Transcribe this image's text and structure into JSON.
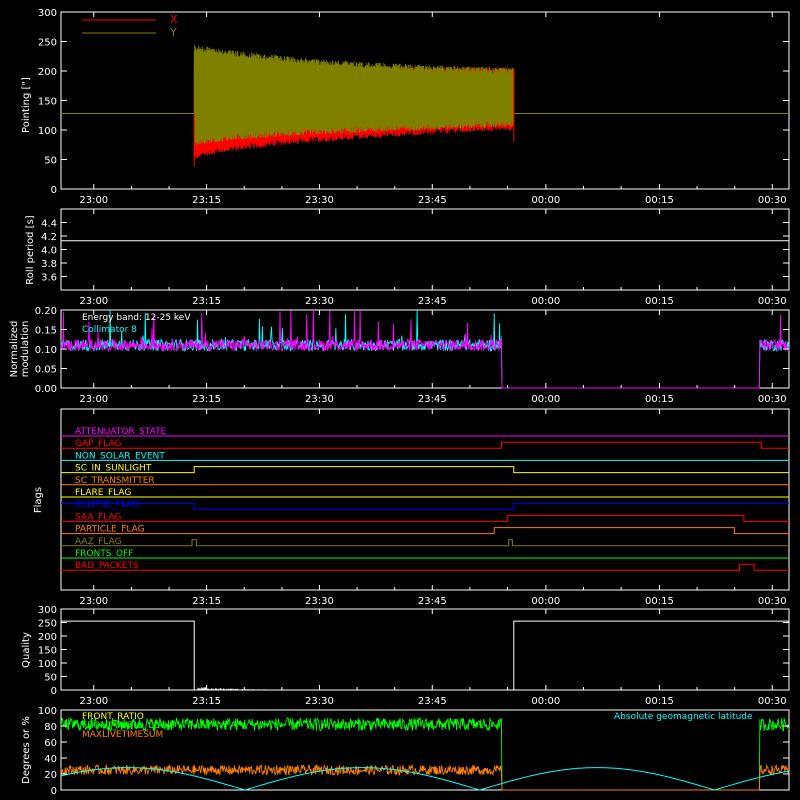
{
  "time_ticks": [
    "23:00",
    "23:15",
    "23:30",
    "23:45",
    "00:00",
    "00:15",
    "00:30"
  ],
  "colors": {
    "x": "#ff0000",
    "y": "#808000",
    "white": "#ffffff",
    "magenta": "#ff00ff",
    "cyan": "#00ffff",
    "green": "#00ff00",
    "orange": "#ff8000",
    "yellow": "#ffff00",
    "blue": "#0000ff",
    "red": "#ff0000",
    "olive": "#808000"
  },
  "chart_data": [
    {
      "id": "pointing",
      "type": "line",
      "ylabel": "Pointing [\"]",
      "ylim": [
        0,
        300
      ],
      "yticks": [
        "0",
        "50",
        "100",
        "150",
        "200",
        "250",
        "300"
      ],
      "legend": [
        {
          "name": "X",
          "color": "#ff0000"
        },
        {
          "name": "Y",
          "color": "#808000"
        }
      ],
      "series": [
        {
          "name": "X",
          "baseline": 128,
          "active": [
            [
              0.183,
              0.622
            ]
          ],
          "low_start": 45,
          "low_end": 100,
          "high_start": 210,
          "high_end": 205
        },
        {
          "name": "Y",
          "baseline": 128,
          "active": [
            [
              0.183,
              0.622
            ]
          ],
          "low_start": 70,
          "low_end": 105,
          "high_start": 245,
          "high_end": 200
        }
      ]
    },
    {
      "id": "roll",
      "type": "line",
      "ylabel": "Roll period [s]",
      "ylim": [
        3.4,
        4.6
      ],
      "yticks": [
        "3.6",
        "3.8",
        "4.0",
        "4.2",
        "4.4"
      ],
      "series": [
        {
          "name": "roll",
          "value": 4.13
        }
      ]
    },
    {
      "id": "modulation",
      "type": "line",
      "ylabel_lines": [
        "Normalized",
        "modulation"
      ],
      "ylim": [
        0,
        0.2
      ],
      "yticks": [
        "0.00",
        "0.05",
        "0.10",
        "0.15",
        "0.20"
      ],
      "annotations": [
        "Energy band: 12-25 keV",
        "Collimator 8"
      ],
      "series": [
        {
          "name": "cyan",
          "mean": 0.11,
          "active": [
            [
              0.0,
              0.605
            ],
            [
              0.96,
              1.0
            ]
          ]
        },
        {
          "name": "magenta",
          "mean": 0.11,
          "active": [
            [
              0.0,
              0.605
            ],
            [
              0.96,
              1.0
            ]
          ]
        }
      ]
    },
    {
      "id": "flags",
      "type": "line",
      "ylabel": "Flags",
      "series": [
        {
          "name": "ATTENUATOR_STATE",
          "color": "#ff00ff",
          "segments": [
            [
              0,
              1.0,
              0
            ]
          ]
        },
        {
          "name": "GAP_FLAG",
          "color": "#ff0000",
          "segments": [
            [
              0,
              0.605,
              0
            ],
            [
              0.605,
              0.962,
              1
            ],
            [
              0.962,
              1.0,
              0
            ]
          ]
        },
        {
          "name": "NON_SOLAR_EVENT",
          "color": "#00ffff",
          "segments": [
            [
              0,
              1.0,
              0
            ]
          ]
        },
        {
          "name": "SC_IN_SUNLIGHT",
          "color": "#ffff00",
          "segments": [
            [
              0,
              0.183,
              0
            ],
            [
              0.183,
              0.622,
              1
            ],
            [
              0.622,
              1.0,
              0
            ]
          ]
        },
        {
          "name": "SC_TRANSMITTER",
          "color": "#ff8000",
          "segments": [
            [
              0,
              1.0,
              0
            ]
          ]
        },
        {
          "name": "FLARE_FLAG",
          "color": "#ffff00",
          "segments": [
            [
              0,
              1.0,
              0
            ]
          ]
        },
        {
          "name": "ECLIPSE_FLAG",
          "color": "#0000ff",
          "segments": [
            [
              0,
              0.183,
              1
            ],
            [
              0.183,
              0.622,
              0
            ],
            [
              0.622,
              1.0,
              1
            ]
          ]
        },
        {
          "name": "SAA_FLAG",
          "color": "#ff0000",
          "segments": [
            [
              0,
              0.613,
              0
            ],
            [
              0.613,
              0.938,
              1
            ],
            [
              0.938,
              1.0,
              0
            ]
          ]
        },
        {
          "name": "PARTICLE_FLAG",
          "color": "#ff8000",
          "segments": [
            [
              0,
              0.595,
              0
            ],
            [
              0.595,
              0.925,
              1
            ],
            [
              0.925,
              1.0,
              0
            ]
          ]
        },
        {
          "name": "AAZ_FLAG",
          "color": "#808000",
          "segments": [
            [
              0,
              0.18,
              0
            ],
            [
              0.18,
              0.186,
              1
            ],
            [
              0.186,
              0.615,
              0
            ],
            [
              0.615,
              0.62,
              1
            ],
            [
              0.62,
              1.0,
              0
            ]
          ]
        },
        {
          "name": "FRONTS_OFF",
          "color": "#00ff00",
          "segments": [
            [
              0,
              1.0,
              0
            ]
          ]
        },
        {
          "name": "BAD_PACKETS",
          "color": "#ff0000",
          "segments": [
            [
              0,
              0.932,
              0
            ],
            [
              0.932,
              0.952,
              1
            ],
            [
              0.952,
              1.0,
              0
            ]
          ]
        }
      ]
    },
    {
      "id": "quality",
      "type": "line",
      "ylabel": "Quality",
      "ylim": [
        0,
        300
      ],
      "yticks": [
        "0",
        "50",
        "100",
        "150",
        "200",
        "250",
        "300"
      ],
      "series": [
        {
          "name": "quality",
          "high": 255,
          "low_window": [
            0.183,
            0.622
          ],
          "decay_end": 0.36
        }
      ]
    },
    {
      "id": "ratio",
      "type": "line",
      "ylabel": "Degrees or %",
      "ylim": [
        0,
        100
      ],
      "yticks": [
        "0",
        "20",
        "40",
        "60",
        "80",
        "100"
      ],
      "legend": [
        {
          "name": "FRONT_RATIO",
          "color": "#ffff00"
        },
        {
          "name": "FRONT_RATIO_LOG",
          "color": "#00ff00"
        },
        {
          "name": "MAXLIVETIMESUM",
          "color": "#ff8000"
        }
      ],
      "annotations": [
        "Absolute geomagnetic latitude"
      ],
      "series": [
        {
          "name": "FRONT_RATIO_LOG",
          "color": "#00ff00",
          "mean": 82,
          "active": [
            [
              0.0,
              0.605
            ],
            [
              0.96,
              1.0
            ]
          ]
        },
        {
          "name": "MAXLIVETIMESUM",
          "color": "#ff8000",
          "mean": 25,
          "active": [
            [
              0.0,
              0.605
            ],
            [
              0.96,
              1.0
            ]
          ]
        },
        {
          "name": "Absolute geomagnetic latitude",
          "color": "#00ffff",
          "min": 0,
          "max": 28
        }
      ]
    }
  ]
}
